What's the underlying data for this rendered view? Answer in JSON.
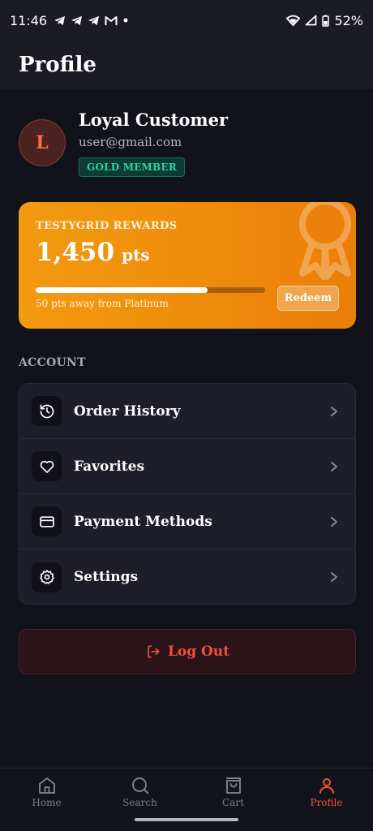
{
  "status_bar": {
    "time": "11:46",
    "battery": "52%"
  },
  "header": {
    "title": "Profile"
  },
  "profile": {
    "initial": "L",
    "name": "Loyal Customer",
    "email": "user@gmail.com",
    "badge": "GOLD MEMBER"
  },
  "rewards": {
    "label": "TESTYGRID REWARDS",
    "points": "1,450",
    "unit": "pts",
    "progress": 0.75,
    "hint": "50 pts away from Platinum",
    "redeem_label": "Redeem"
  },
  "account": {
    "section_title": "ACCOUNT",
    "items": [
      {
        "label": "Order History",
        "icon": "history-icon"
      },
      {
        "label": "Favorites",
        "icon": "heart-icon"
      },
      {
        "label": "Payment Methods",
        "icon": "credit-card-icon"
      },
      {
        "label": "Settings",
        "icon": "gear-icon"
      }
    ]
  },
  "logout": {
    "label": "Log Out"
  },
  "tabbar": {
    "items": [
      {
        "label": "Home",
        "icon": "home-icon"
      },
      {
        "label": "Search",
        "icon": "search-icon"
      },
      {
        "label": "Cart",
        "icon": "shopping-bag-icon"
      },
      {
        "label": "Profile",
        "icon": "user-icon",
        "active": true
      }
    ]
  },
  "colors": {
    "accent": "#f0503a",
    "rewards_orange": "#f29a10",
    "badge_green": "#2ed3a0",
    "background": "#12121a"
  }
}
